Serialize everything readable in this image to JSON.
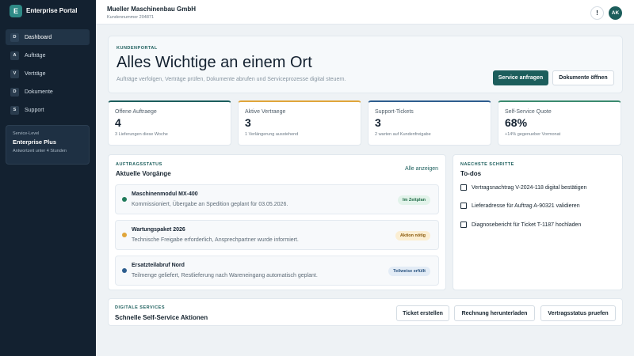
{
  "sidebar": {
    "brand": {
      "logo_letter": "E",
      "title": "Enterprise Portal"
    },
    "items": [
      {
        "badge": "D",
        "label": "Dashboard",
        "active": true
      },
      {
        "badge": "A",
        "label": "Aufträge",
        "active": false
      },
      {
        "badge": "V",
        "label": "Verträge",
        "active": false
      },
      {
        "badge": "D",
        "label": "Dokumente",
        "active": false
      },
      {
        "badge": "S",
        "label": "Support",
        "active": false
      }
    ],
    "service_level": {
      "caption": "Service-Level",
      "level": "Enterprise Plus",
      "note": "Antwortzeit unter 4 Stunden"
    }
  },
  "header": {
    "company": "Mueller Maschinenbau GmbH",
    "customer_number": "Kundennummer 204871",
    "notification_icon": "!",
    "avatar_initials": "AK"
  },
  "hero": {
    "kicker": "KUNDENPORTAL",
    "title": "Alles Wichtige an einem Ort",
    "subtitle": "Aufträge verfolgen, Verträge prüfen, Dokumente abrufen und Serviceprozesse digital steuern.",
    "primary_button": "Service anfragen",
    "secondary_button": "Dokumente öffnen"
  },
  "kpis": [
    {
      "label": "Offene Auftraege",
      "value": "4",
      "note": "3 Lieferungen diese Woche",
      "color": "#1c5e5c"
    },
    {
      "label": "Aktive Vertraege",
      "value": "3",
      "note": "1 Verlängerung ausstehend",
      "color": "#e0a53a"
    },
    {
      "label": "Support-Tickets",
      "value": "3",
      "note": "2 warten auf Kundenfreigabe",
      "color": "#2d5d8e"
    },
    {
      "label": "Self-Service Quote",
      "value": "68%",
      "note": "+14% gegenueber Vormonat",
      "color": "#3a8a6e"
    }
  ],
  "orders": {
    "kicker": "AUFTRAGSSTATUS",
    "title": "Aktuelle Vorgänge",
    "link": "Alle anzeigen",
    "items": [
      {
        "title": "Maschinenmodul MX-400",
        "desc": "Kommissioniert, Übergabe an Spedition geplant für 03.05.2026.",
        "badge": "Im Zeitplan",
        "dot_color": "#1f7a5a",
        "badge_bg": "#e2f3ea",
        "badge_color": "#1f6b47"
      },
      {
        "title": "Wartungspaket 2026",
        "desc": "Technische Freigabe erforderlich, Ansprechpartner wurde informiert.",
        "badge": "Aktion nötig",
        "dot_color": "#e0a53a",
        "badge_bg": "#fbeed2",
        "badge_color": "#8a5a0c"
      },
      {
        "title": "Ersatzteilabruf Nord",
        "desc": "Teilmenge geliefert, Restlieferung nach Wareneingang automatisch geplant.",
        "badge": "Teilweise erfüllt",
        "dot_color": "#2d5d8e",
        "badge_bg": "#e3ecf6",
        "badge_color": "#2a5480"
      }
    ]
  },
  "todos": {
    "kicker": "NAECHSTE SCHRITTE",
    "title": "To-dos",
    "items": [
      "Vertragsnachtrag V-2024-118 digital bestätigen",
      "Lieferadresse für Auftrag A-90321 validieren",
      "Diagnosebericht für Ticket T-1187 hochladen"
    ]
  },
  "services": {
    "kicker": "DIGITALE SERVICES",
    "title": "Schnelle Self-Service Aktionen",
    "buttons": [
      "Ticket erstellen",
      "Rechnung herunterladen",
      "Vertragsstatus pruefen"
    ]
  }
}
